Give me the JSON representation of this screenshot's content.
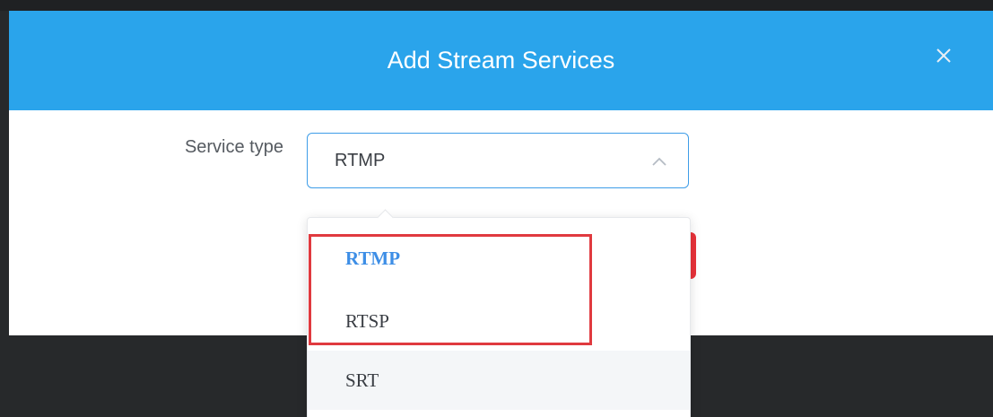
{
  "dialog": {
    "title": "Add Stream Services",
    "close_icon": "close-icon",
    "header_color": "#2aa4eb"
  },
  "form": {
    "service_type_label": "Service type",
    "service_type_value": "RTMP",
    "dropdown_icon": "chevron-up-icon"
  },
  "dropdown": {
    "options": [
      {
        "label": "RTMP",
        "selected": true
      },
      {
        "label": "RTSP",
        "selected": false
      },
      {
        "label": "SRT",
        "selected": false
      }
    ],
    "selected_color": "#3d8ee6"
  },
  "annotation": {
    "highlight_color": "#e03a3f"
  }
}
